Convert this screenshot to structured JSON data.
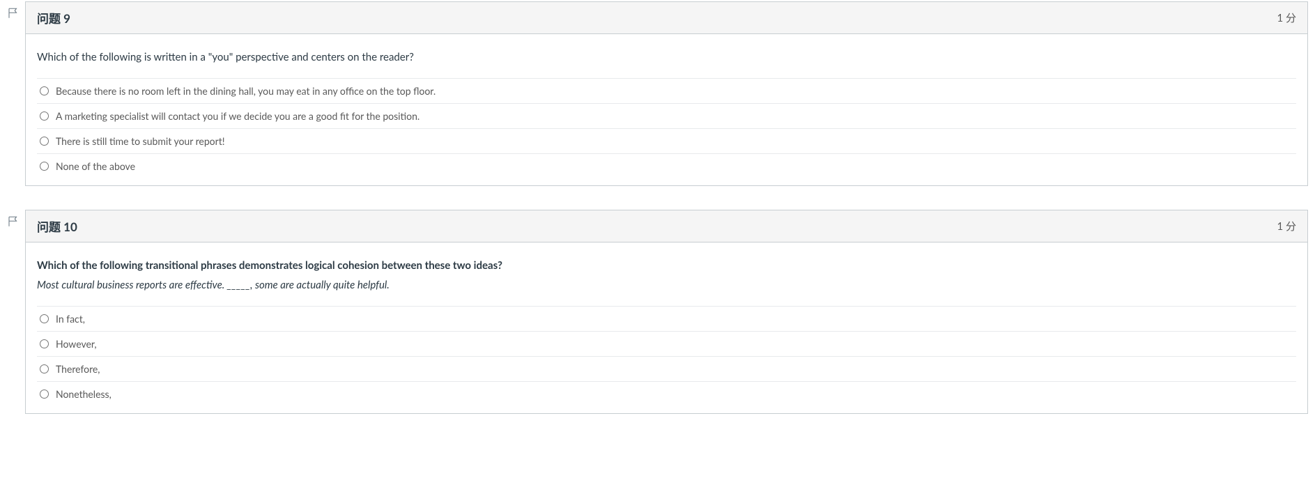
{
  "questions": [
    {
      "title": "问题 9",
      "points": "1 分",
      "prompt": "Which of the following is written in a \"you\" perspective and centers on the reader?",
      "subtext": "",
      "answers": [
        "Because there is no room left in the dining hall, you may eat in any office on the top floor.",
        "A marketing specialist will contact you if we decide you are a good fit for the position.",
        "There is still time to submit your report!",
        "None of the above"
      ]
    },
    {
      "title": "问题 10",
      "points": "1 分",
      "prompt": "Which of the following transitional phrases demonstrates logical cohesion between these two ideas?",
      "subtext": "Most cultural business reports are effective. _____, some are actually quite helpful.",
      "answers": [
        "In fact,",
        "However,",
        "Therefore,",
        "Nonetheless,"
      ]
    }
  ]
}
